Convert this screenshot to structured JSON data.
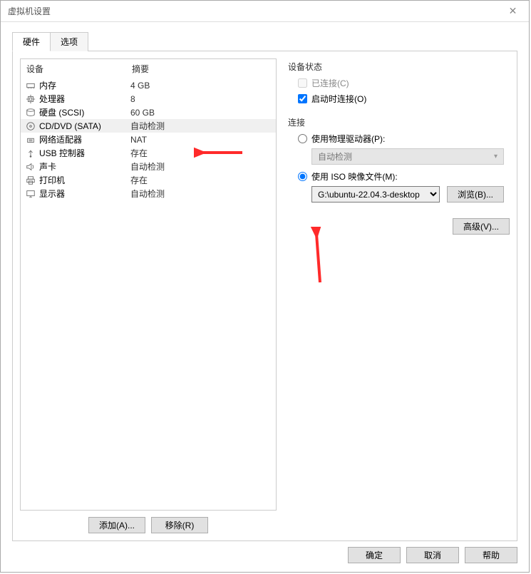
{
  "window": {
    "title": "虚拟机设置"
  },
  "tabs": {
    "hardware": "硬件",
    "options": "选项"
  },
  "list": {
    "header_device": "设备",
    "header_summary": "摘要",
    "rows": [
      {
        "icon": "memory",
        "name": "内存",
        "summary": "4 GB"
      },
      {
        "icon": "cpu",
        "name": "处理器",
        "summary": "8"
      },
      {
        "icon": "disk",
        "name": "硬盘 (SCSI)",
        "summary": "60 GB"
      },
      {
        "icon": "cd",
        "name": "CD/DVD (SATA)",
        "summary": "自动检测",
        "selected": true
      },
      {
        "icon": "net",
        "name": "网络适配器",
        "summary": "NAT"
      },
      {
        "icon": "usb",
        "name": "USB 控制器",
        "summary": "存在"
      },
      {
        "icon": "sound",
        "name": "声卡",
        "summary": "自动检测"
      },
      {
        "icon": "printer",
        "name": "打印机",
        "summary": "存在"
      },
      {
        "icon": "display",
        "name": "显示器",
        "summary": "自动检测"
      }
    ]
  },
  "list_buttons": {
    "add": "添加(A)...",
    "remove": "移除(R)"
  },
  "status": {
    "title": "设备状态",
    "connected": "已连接(C)",
    "connect_at_power": "启动时连接(O)"
  },
  "connection": {
    "title": "连接",
    "physical": "使用物理驱动器(P):",
    "auto_detect": "自动检测",
    "iso": "使用 ISO 映像文件(M):",
    "iso_path": "G:\\ubuntu-22.04.3-desktop",
    "browse": "浏览(B)..."
  },
  "advanced": "高级(V)...",
  "footer": {
    "ok": "确定",
    "cancel": "取消",
    "help": "帮助"
  }
}
